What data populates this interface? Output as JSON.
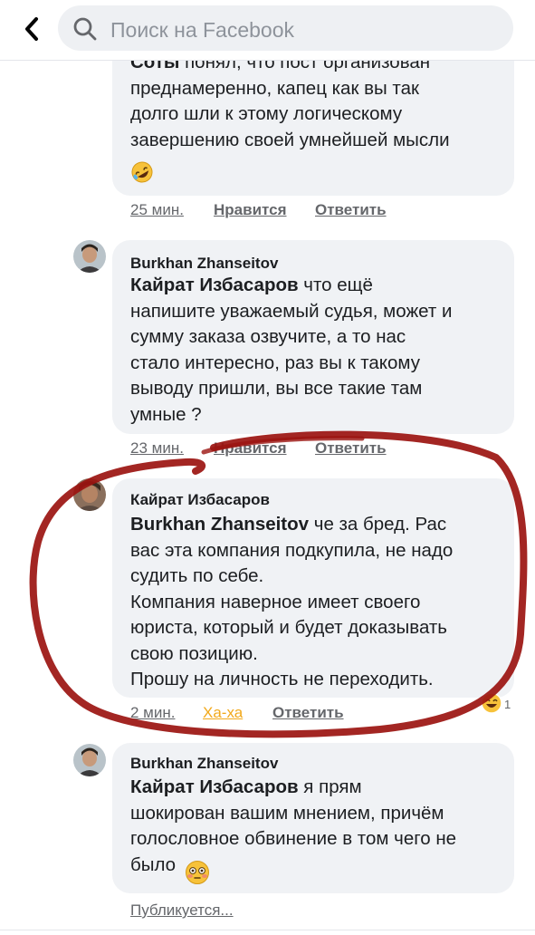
{
  "header": {
    "search_placeholder": "Поиск на Facebook"
  },
  "comments": [
    {
      "author": "Соты",
      "text": "понял, что пост организован\nпреднамеренно, капец как вы так\nдолго шли к этому логическому\nзавершению своей умнейшей мысли",
      "emoji": "rofl-emoji",
      "time": "25 мин.",
      "like_label": "Нравится",
      "reply_label": "Ответить"
    },
    {
      "author": "Burkhan Zhanseitov",
      "mention": "Кайрат Избасаров",
      "text": " что ещё\nнапишите уважаемый судья, может и\nсумму заказа озвучите, а то нас\nстало интересно, раз вы к такому\nвыводу пришли, вы все такие там\nумные ?",
      "time": "23 мин.",
      "like_label": "Нравится",
      "reply_label": "Ответить"
    },
    {
      "author": "Кайрат Избасаров",
      "mention": "Burkhan Zhanseitov",
      "text": " че за бред. Рас\nвас эта компания подкупила, не надо\nсудить по себе.\nКомпания наверное имеет своего\nюриста, который и будет доказывать\nсвою позицию.\nПрошу на личность не переходить.",
      "time": "2 мин.",
      "like_label": "Ха-ха",
      "reply_label": "Ответить",
      "reaction_count": "1",
      "reaction_icon": "laughing-emoji"
    },
    {
      "author": "Burkhan Zhanseitov",
      "mention": "Кайрат Избасаров",
      "text": " я прям\nшокирован вашим мнением, причём\nголословное обвинение в том чего не\nбыло",
      "emoji": "flushed-emoji",
      "status": "Публикуется..."
    }
  ],
  "colors": {
    "bubble": "#f0f2f5",
    "haha": "#f2a91b",
    "annotation": "#9b1410"
  }
}
